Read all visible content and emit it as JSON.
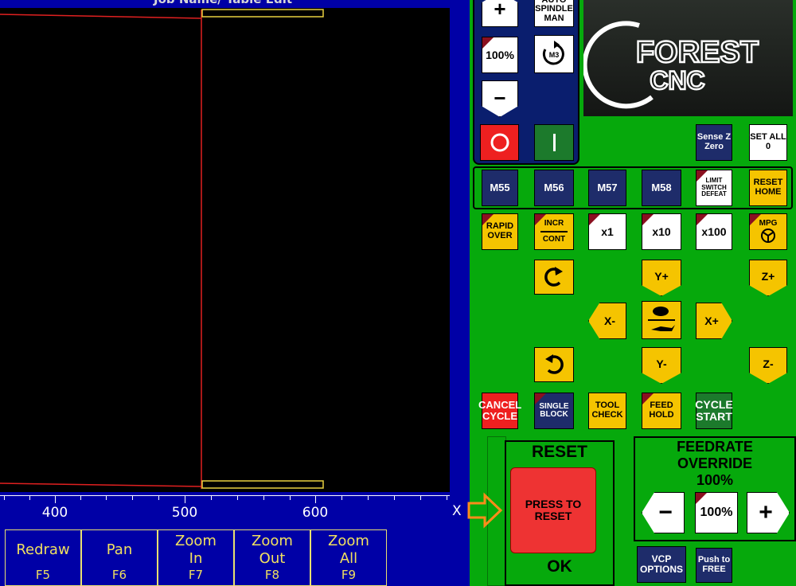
{
  "title": "Job Name/ Table Edit",
  "ruler": {
    "labels": [
      "400",
      "500",
      "600"
    ],
    "axis": "X"
  },
  "fkeys": [
    {
      "label": "Redraw",
      "key": "F5"
    },
    {
      "label": "Pan",
      "key": "F6"
    },
    {
      "label": "Zoom In",
      "key": "F7"
    },
    {
      "label": "Zoom Out",
      "key": "F8"
    },
    {
      "label": "Zoom All",
      "key": "F9"
    }
  ],
  "spindle": {
    "plus": "+",
    "auto_man": "AUTO SPINDLE MAN",
    "percent": "100%",
    "m3": "M3",
    "minus": "−",
    "stop": "O",
    "start": "I"
  },
  "logo": {
    "line1": "FOREST",
    "line2": "CNC"
  },
  "sense_z_zero": "Sense Z Zero",
  "set_all_0": "SET ALL 0",
  "mcodes": [
    "M55",
    "M56",
    "M57",
    "M58"
  ],
  "limit_switch_defeat": "LIMIT SWITCH DEFEAT",
  "reset_home": "RESET HOME",
  "rapid_over": "RAPID OVER",
  "incr_cont": {
    "top": "INCR",
    "bottom": "CONT"
  },
  "steps": [
    "x1",
    "x10",
    "x100"
  ],
  "mpg": "MPG",
  "jog": {
    "y_plus": "Y+",
    "y_minus": "Y-",
    "x_minus": "X-",
    "x_plus": "X+",
    "z_plus": "Z+",
    "z_minus": "Z-"
  },
  "cycle": {
    "cancel": "CANCEL CYCLE",
    "single_block": "SINGLE BLOCK",
    "tool_check": "TOOL CHECK",
    "feed_hold": "FEED HOLD",
    "cycle_start": "CYCLE START"
  },
  "reset": {
    "title": "RESET",
    "press": "PRESS TO RESET",
    "ok": "OK"
  },
  "feedrate": {
    "title": "FEEDRATE OVERRIDE",
    "percent": "100%",
    "value": "100%",
    "minus": "−",
    "plus": "+"
  },
  "vcp_options": "VCP OPTIONS",
  "push_to_free": "Push to FREE",
  "colors": {
    "navy": "#1e2c6a",
    "green": "#06a90c",
    "yellow": "#f5c400",
    "red": "#ee3333",
    "blue": "#0000a6"
  }
}
